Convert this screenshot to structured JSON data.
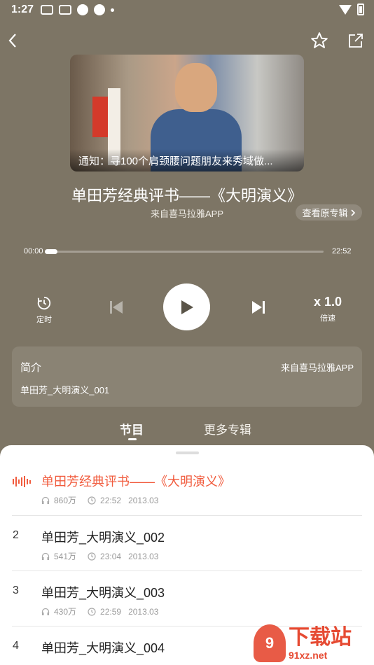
{
  "status_bar": {
    "time": "1:27"
  },
  "cover": {
    "caption": "通知：寻100个肩颈腰问题朋友来秀域做..."
  },
  "album": {
    "title": "单田芳经典评书——《大明演义》",
    "source": "来自喜马拉雅APP",
    "view_original": "查看原专辑"
  },
  "progress": {
    "current": "00:00",
    "total": "22:52",
    "fraction": 0.01
  },
  "controls": {
    "timer_label": "定时",
    "speed_value": "x 1.0",
    "speed_label": "倍速"
  },
  "intro": {
    "title": "简介",
    "source": "来自喜马拉雅APP",
    "description": "单田芳_大明演义_001"
  },
  "tabs": [
    {
      "label": "节目"
    },
    {
      "label": "更多专辑"
    }
  ],
  "episodes": [
    {
      "index": "",
      "title": "单田芳经典评书——《大明演义》",
      "plays": "860万",
      "duration": "22:52",
      "date": "2013.03",
      "playing": true
    },
    {
      "index": "2",
      "title": "单田芳_大明演义_002",
      "plays": "541万",
      "duration": "23:04",
      "date": "2013.03",
      "playing": false
    },
    {
      "index": "3",
      "title": "单田芳_大明演义_003",
      "plays": "430万",
      "duration": "22:59",
      "date": "2013.03",
      "playing": false
    },
    {
      "index": "4",
      "title": "单田芳_大明演义_004",
      "plays": "",
      "duration": "",
      "date": "",
      "playing": false
    }
  ],
  "watermark": {
    "main": "下载站",
    "sub": "91xz.net"
  },
  "colors": {
    "background": "#7d7565",
    "accent": "#f15b3d"
  }
}
